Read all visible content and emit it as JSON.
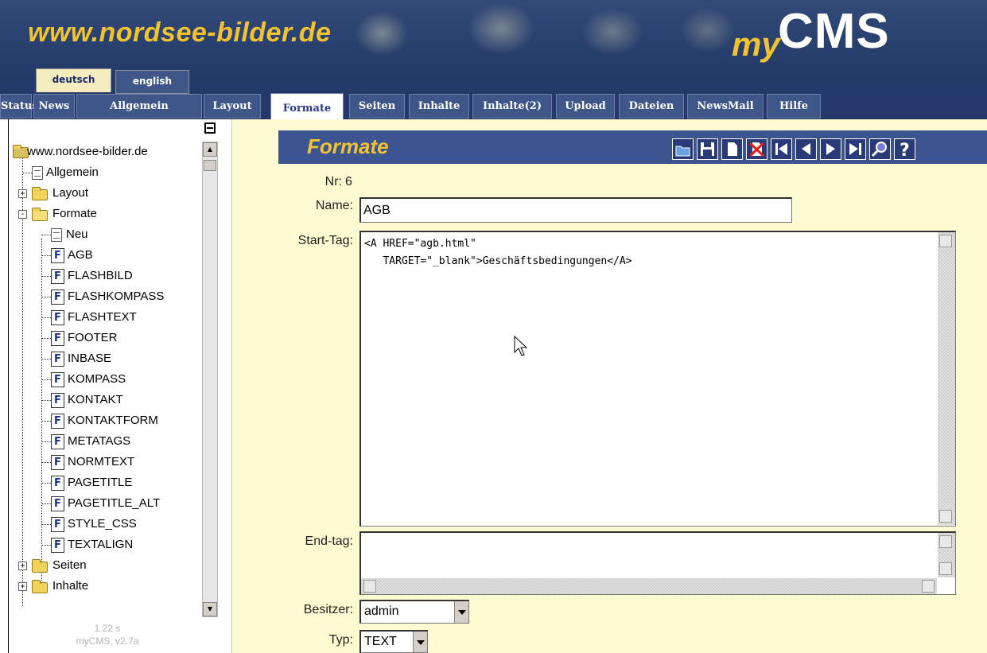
{
  "header": {
    "site_title": "www.nordsee-bilder.de",
    "brand_my": "my",
    "brand_cms": "CMS"
  },
  "languages": [
    {
      "label": "deutsch",
      "active": true
    },
    {
      "label": "english",
      "active": false
    }
  ],
  "nav": {
    "tabs": [
      {
        "label": "Status"
      },
      {
        "label": "News"
      },
      {
        "label": "Allgemein"
      },
      {
        "label": "Layout"
      },
      {
        "label": "Formate",
        "active": true
      },
      {
        "label": "Seiten"
      },
      {
        "label": "Inhalte"
      },
      {
        "label": "Inhalte(2)"
      },
      {
        "label": "Upload"
      },
      {
        "label": "Dateien"
      },
      {
        "label": "NewsMail"
      },
      {
        "label": "Hilfe"
      }
    ]
  },
  "tree": {
    "root": "www.nordsee-bilder.de",
    "items": [
      {
        "label": "Allgemein",
        "icon": "document-icon"
      },
      {
        "label": "Layout",
        "icon": "folder-icon",
        "expander": "+"
      },
      {
        "label": "Formate",
        "icon": "folder-open-icon",
        "expander": "-"
      },
      {
        "label": "Neu",
        "icon": "new-document-icon"
      },
      {
        "label": "AGB",
        "icon": "format-icon"
      },
      {
        "label": "FLASHBILD",
        "icon": "format-icon"
      },
      {
        "label": "FLASHKOMPASS",
        "icon": "format-icon"
      },
      {
        "label": "FLASHTEXT",
        "icon": "format-icon"
      },
      {
        "label": "FOOTER",
        "icon": "format-icon"
      },
      {
        "label": "INBASE",
        "icon": "format-icon"
      },
      {
        "label": "KOMPASS",
        "icon": "format-icon"
      },
      {
        "label": "KONTAKT",
        "icon": "format-icon"
      },
      {
        "label": "KONTAKTFORM",
        "icon": "format-icon"
      },
      {
        "label": "METATAGS",
        "icon": "format-icon"
      },
      {
        "label": "NORMTEXT",
        "icon": "format-icon"
      },
      {
        "label": "PAGETITLE",
        "icon": "format-icon"
      },
      {
        "label": "PAGETITLE_ALT",
        "icon": "format-icon"
      },
      {
        "label": "STYLE_CSS",
        "icon": "format-icon"
      },
      {
        "label": "TEXTALIGN",
        "icon": "format-icon"
      },
      {
        "label": "Seiten",
        "icon": "folder-icon",
        "expander": "+"
      },
      {
        "label": "Inhalte",
        "icon": "folder-icon",
        "expander": "+"
      }
    ],
    "format_icon_glyph": "F"
  },
  "footer": {
    "time": "1.22 s",
    "version": "myCMS, v2.7a"
  },
  "form": {
    "title": "Formate",
    "toolbar_icons": [
      "open-icon",
      "save-icon",
      "new-icon",
      "delete-icon",
      "first-icon",
      "previous-icon",
      "next-icon",
      "last-icon",
      "search-icon",
      "help-icon"
    ],
    "nr_label": "Nr:",
    "nr_value": "6",
    "name_label": "Name:",
    "name_value": "AGB",
    "starttag_label": "Start-Tag:",
    "starttag_value": "<A HREF=\"agb.html\"\n   TARGET=\"_blank\">Geschäftsbedingungen</A>",
    "endtag_label": "End-tag:",
    "endtag_value": "",
    "besitzer_label": "Besitzer:",
    "besitzer_value": "admin",
    "typ_label": "Typ:",
    "typ_value": "TEXT"
  },
  "colors": {
    "banner_bg": "#263e6b",
    "accent_yellow": "#f1c232",
    "content_bg": "#fdfbd2",
    "title_bar": "#3c5490"
  }
}
